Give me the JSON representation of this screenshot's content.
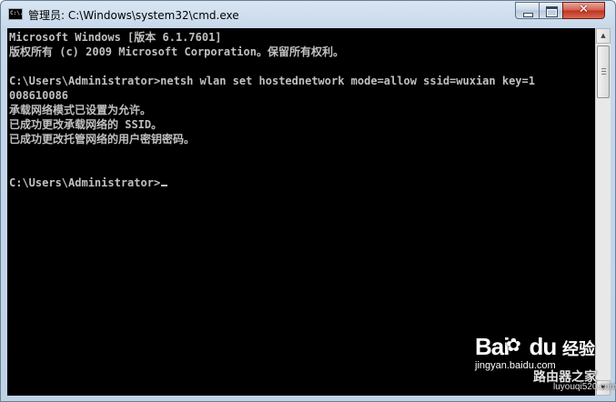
{
  "window": {
    "title": "管理员: C:\\Windows\\system32\\cmd.exe",
    "icon": "cmd-icon",
    "icon_text": "C:\\."
  },
  "console": {
    "lines": [
      "Microsoft Windows [版本 6.1.7601]",
      "版权所有 (c) 2009 Microsoft Corporation。保留所有权利。",
      "",
      "C:\\Users\\Administrator>netsh wlan set hostednetwork mode=allow ssid=wuxian key=1",
      "008610086",
      "承载网络模式已设置为允许。",
      "已成功更改承载网络的 SSID。",
      "已成功更改托管网络的用户密钥密码。",
      "",
      "",
      "C:\\Users\\Administrator>"
    ]
  },
  "watermark": {
    "logo": "Bai",
    "logo_suffix": "du",
    "brand": "经验",
    "url": "jingyan.baidu.com",
    "site": "路由器之家",
    "site_url": "luyouqi520.com"
  },
  "colors": {
    "console_bg": "#000000",
    "console_fg": "#c0c0c0",
    "close_button": "#c0301f"
  }
}
